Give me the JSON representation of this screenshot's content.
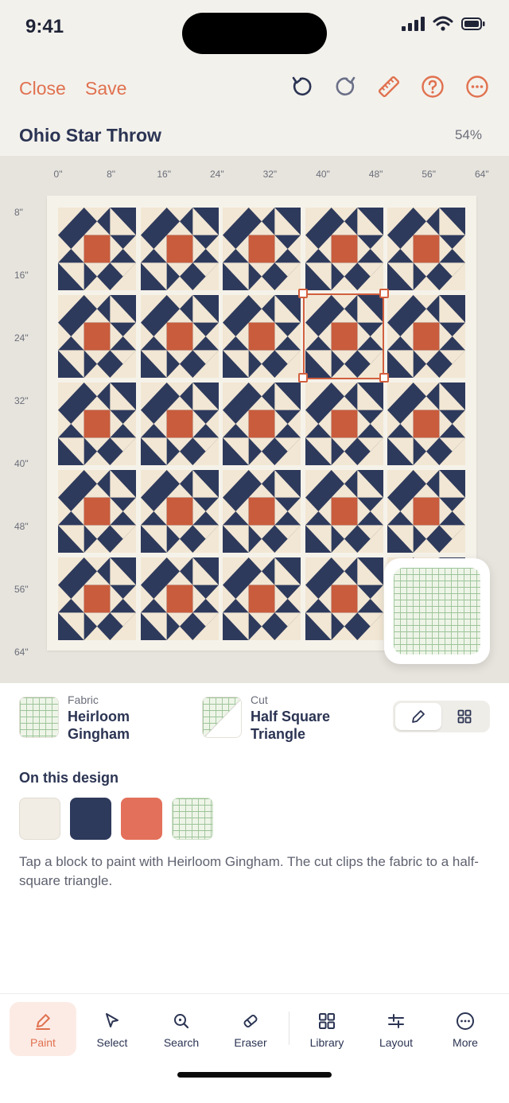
{
  "status": {
    "time": "9:41"
  },
  "toolbar": {
    "close_label": "Close",
    "save_label": "Save",
    "icons": [
      "undo-icon",
      "redo-icon",
      "ruler-icon",
      "help-icon",
      "more-icon"
    ]
  },
  "design": {
    "title": "Ohio Star Throw",
    "zoom": "54%"
  },
  "ruler": {
    "x": [
      "0\"",
      "8\"",
      "16\"",
      "24\"",
      "32\"",
      "40\"",
      "48\"",
      "56\"",
      "64\""
    ],
    "y": [
      "8\"",
      "16\"",
      "24\"",
      "32\"",
      "40\"",
      "48\"",
      "56\"",
      "64\""
    ]
  },
  "quilt": {
    "rows": 5,
    "cols": 5,
    "selected_block": {
      "row": 2,
      "col": 4
    }
  },
  "colors": {
    "cream": "#f2e7d4",
    "navy": "#2e3a5c",
    "rust": "#c85c3c",
    "accent": "#e0714f",
    "gingham": "#eef5e8"
  },
  "selection": {
    "fabric_label": "Fabric",
    "fabric_name": "Heirloom Gingham",
    "cut_label": "Cut",
    "cut_name": "Half Square Triangle"
  },
  "palette": {
    "title": "On this design",
    "swatches": [
      "#f1ede5",
      "#2e3a5c",
      "#e3705a",
      "gingham"
    ]
  },
  "helper_text": "Tap a block to paint with Heirloom Gingham. The cut clips the fabric to a half-square triangle.",
  "tabs": [
    {
      "label": "Paint",
      "icon": "paint-icon",
      "active": true
    },
    {
      "label": "Select",
      "icon": "select-cursor-icon"
    },
    {
      "label": "Search",
      "icon": "search-icon"
    },
    {
      "label": "Eraser",
      "icon": "eraser-icon"
    },
    {
      "label": "Library",
      "icon": "library-grid-icon"
    },
    {
      "label": "Layout",
      "icon": "layout-sliders-icon"
    },
    {
      "label": "More",
      "icon": "more-icon"
    }
  ]
}
